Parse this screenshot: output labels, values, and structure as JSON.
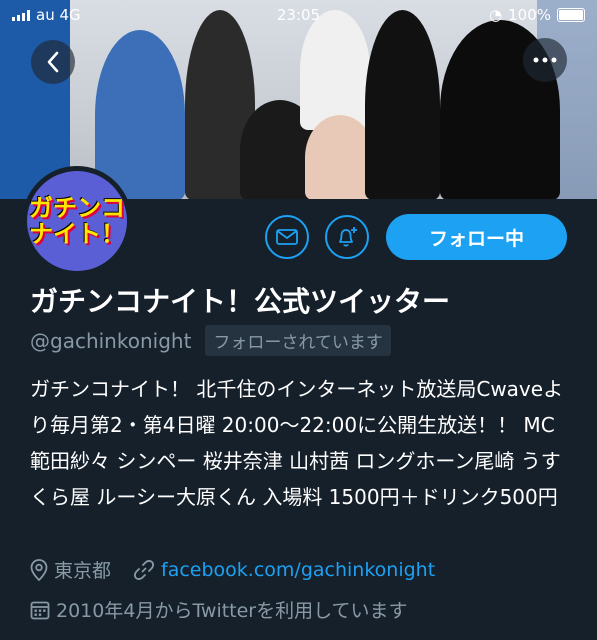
{
  "status_bar": {
    "carrier": "au 4G",
    "time": "23:05",
    "battery": "100%"
  },
  "header": {
    "back_icon": "chevron-left-icon",
    "more_icon": "more-dots-icon"
  },
  "profile": {
    "avatar_text": "ガチンコ\nナイト！",
    "name": "ガチンコナイト！公式ツイッター",
    "handle": "@gachinkonight",
    "follows_you": "フォローされています",
    "bio": "ガチンコナイト！ 北千住のインターネット放送局Cwaveより毎月第2・第4日曜 20:00〜22:00に公開生放送！！ MC 範田紗々 シンペー 桜井奈津 山村茜 ロングホーン尾崎 うすくら屋 ルーシー大原くん 入場料 1500円＋ドリンク500円",
    "location": "東京都",
    "website": "facebook.com/gachinkonight",
    "joined": "2010年4月からTwitterを利用しています"
  },
  "actions": {
    "follow_label": "フォロー中",
    "message_icon": "envelope-icon",
    "notify_icon": "bell-plus-icon"
  },
  "colors": {
    "background": "#15202b",
    "accent": "#1da1f2",
    "secondary_text": "#8899a6"
  }
}
